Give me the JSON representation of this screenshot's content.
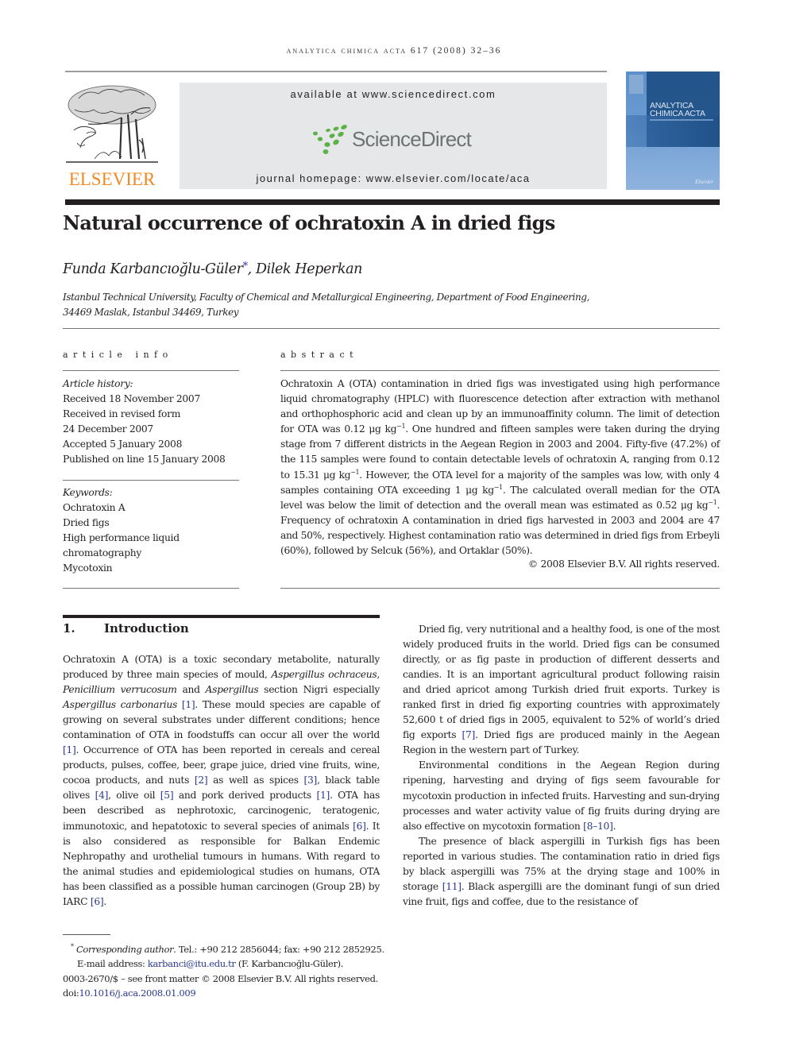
{
  "header": {
    "running_head": "analytica chimica acta 617 (2008) 32–36",
    "publisher_logo_text": "ELSEVIER",
    "banner_available": "available at www.sciencedirect.com",
    "banner_brand": "ScienceDirect",
    "banner_homepage": "journal homepage: www.elsevier.com/locate/aca",
    "cover": {
      "title_line1": "ANALYTICA",
      "title_line2": "CHIMICA ACTA",
      "publisher_mark": "Elsevier"
    },
    "colors": {
      "elsevier_orange": "#f08a24",
      "sciencedirect_green": "#5cb146",
      "sciencedirect_grey": "#6d7375",
      "link_blue": "#2b3990",
      "banner_grey": "#e6e7e8",
      "cover_blue": "#1e4f86"
    }
  },
  "article": {
    "title": "Natural occurrence of ochratoxin A in dried figs",
    "authors": {
      "author1": "Funda Karbancıoğlu-Güler",
      "author1_mark": "*",
      "separator": ", ",
      "author2": "Dilek Heperkan"
    },
    "affiliation_line1": "Istanbul Technical University, Faculty of Chemical and Metallurgical Engineering, Department of Food Engineering,",
    "affiliation_line2": "34469 Maslak, Istanbul 34469, Turkey"
  },
  "article_info": {
    "heading": "article info",
    "history_label": "Article history:",
    "history": [
      "Received 18 November 2007",
      "Received in revised form",
      "24 December 2007",
      "Accepted 5 January 2008",
      "Published on line 15 January 2008"
    ],
    "keywords_label": "Keywords:",
    "keywords": [
      "Ochratoxin A",
      "Dried figs",
      "High performance liquid",
      "chromatography",
      "Mycotoxin"
    ]
  },
  "abstract": {
    "heading": "abstract",
    "t1": "Ochratoxin A (OTA) contamination in dried figs was investigated using high performance liquid chromatography (HPLC) with fluorescence detection after extraction with methanol and orthophosphoric acid and clean up by an immunoaffinity column. The limit of detection for OTA was 0.12 μg kg",
    "t2": ". One hundred and fifteen samples were taken during the drying stage from 7 different districts in the Aegean Region in 2003 and 2004. Fifty-five (47.2%) of the 115 samples were found to contain detectable levels of ochratoxin A, ranging from 0.12 to 15.31 μg kg",
    "t3": ". However, the OTA level for a majority of the samples was low, with only 4 samples containing OTA exceeding 1 μg kg",
    "t4": ". The calculated overall median for the OTA level was below the limit of detection and the overall mean was estimated as 0.52 μg kg",
    "t5": ". Frequency of ochratoxin A contamination in dried figs harvested in 2003 and 2004 are 47 and 50%, respectively. Highest contamination ratio was determined in dried figs from Erbeyli (60%), followed by Selcuk (56%), and Ortaklar (50%).",
    "exp": "−1",
    "copyright": "© 2008 Elsevier B.V. All rights reserved."
  },
  "intro": {
    "number": "1.",
    "heading": "Introduction",
    "p1": {
      "a": "Ochratoxin A (OTA) is a toxic secondary metabolite, naturally produced by three main species of mould, ",
      "i1": "Aspergillus ochraceus",
      "b": ", ",
      "i2": "Penicillium verrucosum",
      "c": " and ",
      "i3": "Aspergillus",
      "d": " section Nigri especially ",
      "i4": "Aspergillus carbonarius",
      "e": " ",
      "r1": "[1]",
      "f": ". These mould species are capable of growing on several substrates under different conditions; hence contamination of OTA in foodstuffs can occur all over the world ",
      "r2": "[1]",
      "g": ". Occurrence of OTA has been reported in cereals and cereal products, pulses, coffee, beer, grape juice, dried vine fruits, wine, cocoa products, and nuts ",
      "r3": "[2]",
      "h": " as well as spices ",
      "r4": "[3]",
      "j": ", black table olives ",
      "r5": "[4]",
      "k": ", olive oil ",
      "r6": "[5]",
      "l": " and pork derived products ",
      "r7": "[1]",
      "m": ". OTA has been described as nephrotoxic, carcinogenic, teratogenic, immunotoxic, and hepatotoxic to several species of animals ",
      "r8": "[6]",
      "n": ". It is also considered as responsible for Balkan Endemic Nephropathy and urothelial tumours in humans. With regard to the animal studies and epidemiological studies on humans, OTA has been classified as a possible human carcinogen (Group 2B) by IARC ",
      "r9": "[6]",
      "o": "."
    },
    "p2": {
      "a": "Dried fig, very nutritional and a healthy food, is one of the most widely produced fruits in the world. Dried figs can be consumed directly, or as fig paste in production of different desserts and candies. It is an important agricultural product following raisin and dried apricot among Turkish dried fruit exports. Turkey is ranked first in dried fig exporting countries with approximately 52,600 t of dried figs in 2005, equivalent to 52% of world’s dried fig exports ",
      "r1": "[7]",
      "b": ". Dried figs are produced mainly in the Aegean Region in the western part of Turkey."
    },
    "p3": {
      "a": "Environmental conditions in the Aegean Region during ripening, harvesting and drying of figs seem favourable for mycotoxin production in infected fruits. Harvesting and sun-drying processes and water activity value of fig fruits during drying are also effective on mycotoxin formation ",
      "r1": "[8–10]",
      "b": "."
    },
    "p4": {
      "a": "The presence of black aspergilli in Turkish figs has been reported in various studies. The contamination ratio in dried figs by black aspergilli was 75% at the drying stage and 100% in storage ",
      "r1": "[11]",
      "b": ". Black aspergilli are the dominant fungi of sun dried vine fruit, figs and coffee, due to the resistance of"
    }
  },
  "footnotes": {
    "mark": "*",
    "corr_label": "Corresponding author",
    "corr_text": ". Tel.: +90 212 2856044; fax: +90 212 2852925.",
    "email_label": "E-mail address: ",
    "email": "karbanci@itu.edu.tr",
    "email_name": " (F. Karbancıoğlu-Güler).",
    "issn_line": "0003-2670/$ – see front matter © 2008 Elsevier B.V. All rights reserved.",
    "doi_label": "doi:",
    "doi": "10.1016/j.aca.2008.01.009"
  }
}
